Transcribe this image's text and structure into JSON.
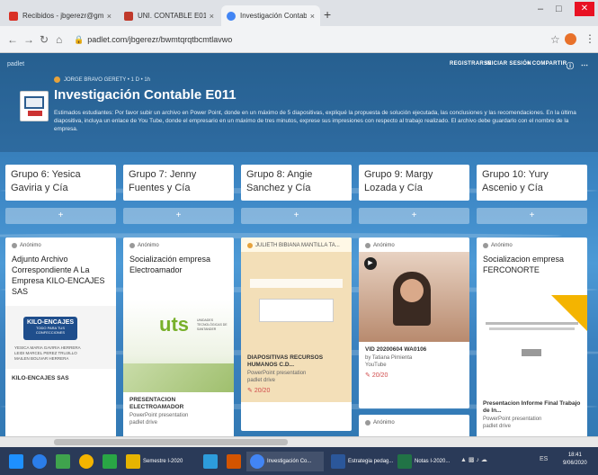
{
  "browser": {
    "tabs": [
      {
        "title": "Recibidos - jbgerezr@gmail.com",
        "color": "#d93025"
      },
      {
        "title": "UNI. CONTABLE E011",
        "color": "#c0392b"
      },
      {
        "title": "Investigación Contable E011",
        "color": "#4285f4"
      }
    ],
    "url": "padlet.com/jbgerezr/bwmtqrqtbcmtlavwo",
    "new_tab_label": "+",
    "close_tab_label": "×"
  },
  "padlet": {
    "logo": "padlet",
    "menu": [
      "REGISTRARSE",
      "INICIAR SESIÓN",
      "+ COMPARTIR"
    ],
    "author_meta": "JORGE BRAVO GERETY • 1 D • 1h",
    "title": "Investigación Contable E011",
    "description": "Estimados estudiantes: Por favor subir un archivo en Power Point, donde en un máximo de 5 diapositivas, expliqué la propuesta de solución ejecutada, las conclusiones y las recomendaciones. En la última diapositiva, incluya un enlace de You Tube, donde el empresario en un máximo de tres minutos, exprese sus impresiones con respecto al trabajo realizado. El archivo debe guardarlo con el nombre de la empresa."
  },
  "columns": [
    {
      "header": "Grupo 6: Yesica Gaviria y Cía"
    },
    {
      "header": "Grupo 7: Jenny Fuentes y Cía"
    },
    {
      "header": "Grupo 8: Angie Sanchez y Cía"
    },
    {
      "header": "Grupo 9: Margy Lozada y Cía"
    },
    {
      "header": "Grupo 10: Yury Ascenio y Cía"
    }
  ],
  "add_label": "+",
  "cards": {
    "c1": {
      "meta": "Anónimo",
      "title": "Adjunto Archivo Correspondiente A La Empresa KILO-ENCAJES SAS",
      "img_text": "KILO-ENCAJES",
      "img_sub": "TODO PARA TUS CONFECCIONES",
      "line1": "YESICA MARIA GAVIRIA HERRERA",
      "line2": "LEIDI MARCEL PEREZ TRUJILLO",
      "line3": "MAILEN BOLIVAR HERRERA",
      "footer": "KILO-ENCAJES SAS"
    },
    "c2": {
      "meta": "Anónimo",
      "title": "Socialización empresa Electroamador",
      "logo": "uts",
      "logo_sub": "UNIDADES TECNOLÓGICAS DE SANTANDER",
      "caption": "PRESENTACION ELECTROAMADOR",
      "sub": "PowerPoint presentation",
      "sub2": "padlet drive"
    },
    "c3": {
      "meta": "JULIETH BIBIANA MANTILLA TA...",
      "caption": "DIAPOSITIVAS RECURSOS HUMANOS C.D...",
      "sub": "PowerPoint presentation",
      "sub2": "padlet drive",
      "comment": "20/20"
    },
    "c4": {
      "meta": "Anónimo",
      "caption": "VID 20200604 WA0106",
      "sub": "by Tatiana Pimienta",
      "sub2": "YouTube",
      "comment": "20/20",
      "meta2": "Anónimo"
    },
    "c5": {
      "meta": "Anónimo",
      "title": "Socializacion empresa FERCONORTE",
      "caption": "Presentacion Informe Final Trabajo de In...",
      "sub": "PowerPoint presentation",
      "sub2": "padlet drive"
    }
  },
  "taskbar": {
    "items": [
      {
        "label": "",
        "color": "#1e90ff"
      },
      {
        "label": "",
        "color": "#2b7de9"
      },
      {
        "label": "",
        "color": "#3fa34d"
      },
      {
        "label": "",
        "color": "#f4b400"
      },
      {
        "label": "",
        "color": "#29a645"
      },
      {
        "label": "Semestre I-2020",
        "color": "#e6b400"
      },
      {
        "label": "",
        "color": "#2d9cdb"
      },
      {
        "label": "",
        "color": "#d35400"
      },
      {
        "label": "Investigación Co...",
        "color": "#4285f4"
      },
      {
        "label": "Estrategia pedag...",
        "color": "#2b579a"
      },
      {
        "label": "Notas I-2020...",
        "color": "#217346"
      }
    ],
    "time": "18:41",
    "date": "9/06/2020",
    "lang": "ES"
  }
}
